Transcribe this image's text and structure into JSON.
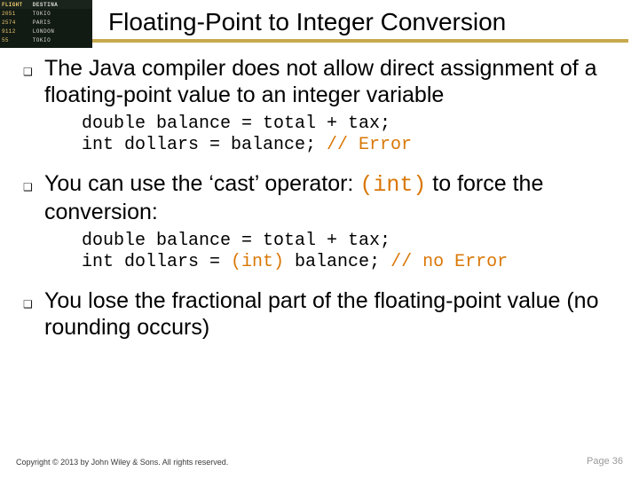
{
  "corner": {
    "hdr_left": "FLIGHT",
    "hdr_right": "DESTINA",
    "rows": [
      {
        "l": "2051",
        "r": "TOKIO"
      },
      {
        "l": "2574",
        "r": "PARIS"
      },
      {
        "l": "9112",
        "r": "LONDON"
      },
      {
        "l": "55",
        "r": "TOKIO"
      }
    ]
  },
  "title": "Floating-Point to Integer Conversion",
  "bullets": {
    "b1": "The Java compiler does not allow direct assignment of a floating-point value to an integer variable",
    "b2_pre": "You can use the ‘cast’ operator: ",
    "b2_cast": "(int)",
    "b2_post": " to force the conversion:",
    "b3": "You lose the fractional part of the floating-point value (no rounding occurs)"
  },
  "code1": {
    "l1": "double balance = total + tax;",
    "l2a": "int dollars = balance; ",
    "l2b": "// Error"
  },
  "code2": {
    "l1": "double balance = total + tax;",
    "l2a": "int dollars = ",
    "l2b": "(int)",
    "l2c": " balance; ",
    "l2d": "// no Error"
  },
  "footer": {
    "copy": "Copyright © 2013 by John Wiley & Sons. All rights reserved.",
    "page": "Page 36"
  }
}
